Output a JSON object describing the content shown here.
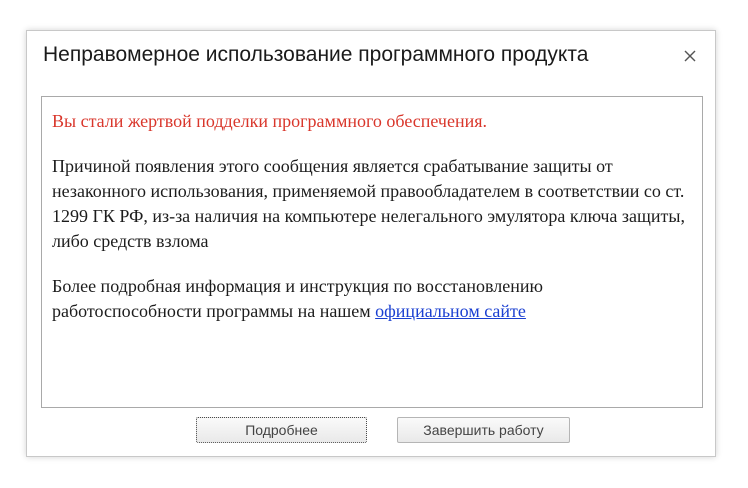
{
  "dialog": {
    "title": "Неправомерное использование программного продукта",
    "close_icon": "close-icon"
  },
  "message": {
    "warning": "Вы стали жертвой подделки программного обеспечения.",
    "body": "Причиной появления этого сообщения является срабатывание защиты от незаконного использования, применяемой правообладателем в соответствии со ст. 1299 ГК РФ, из-за наличия на компьютере нелегального эмулятора ключа защиты, либо средств взлома",
    "info_prefix": "Более подробная информация и инструкция по восстановлению работоспособности программы на нашем ",
    "link_text": "официальном сайте"
  },
  "buttons": {
    "details_label": "Подробнее",
    "finish_label": "Завершить работу"
  },
  "colors": {
    "warning": "#d9362b",
    "link": "#1a3fd1"
  }
}
